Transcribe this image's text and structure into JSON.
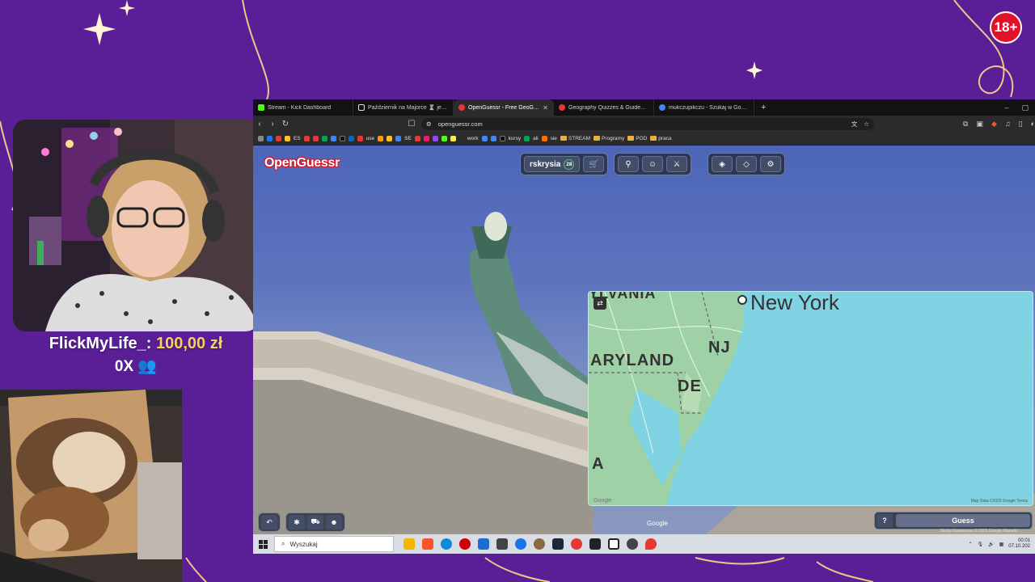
{
  "overlay": {
    "age_badge": "18+",
    "donation_user": "FlickMyLife_:",
    "donation_amount": "100,00 zł",
    "multiplier": "0X"
  },
  "browser": {
    "tabs": [
      {
        "label": "Stream - Kick Dashboard",
        "color": "#53fc18",
        "active": false
      },
      {
        "label": "Październik na Majorce ⏳ jest to na",
        "color": "#111111",
        "active": false
      },
      {
        "label": "OpenGuessr - Free GeoGuessr Al",
        "color": "#e53935",
        "active": true
      },
      {
        "label": "Geography Quizzes & Guides | Oper",
        "color": "#e53935",
        "active": false
      },
      {
        "label": "mukczupikczu - Szukaj w Google",
        "color": "#4285f4",
        "active": false
      }
    ],
    "new_tab": "+",
    "url": "openguessr.com",
    "bookmarks": {
      "items": [
        "ES",
        "SE",
        "use",
        "work",
        "kursy",
        "ali",
        "sie"
      ],
      "folders": [
        "STREAM",
        "Programy",
        "POD",
        "praca"
      ]
    }
  },
  "game": {
    "logo": "OpenGuessr",
    "username": "rskrysia",
    "level": "28",
    "map_labels": {
      "city": "New York",
      "state1": "YLVANIA",
      "state2": "NJ",
      "state3": "ARYLAND",
      "state4": "DE",
      "state5": "A"
    },
    "map_credit": "Map Data ©2025 Google    Terms",
    "map_google": "Google",
    "sv_google": "Google",
    "sv_credit": "Skróty klawiszowe   © 2025 Google   Warunki",
    "help_label": "?",
    "guess_label": "Guess"
  },
  "taskbar": {
    "search_placeholder": "Wyszukaj",
    "time": "00:01",
    "date": "07.10.202"
  }
}
